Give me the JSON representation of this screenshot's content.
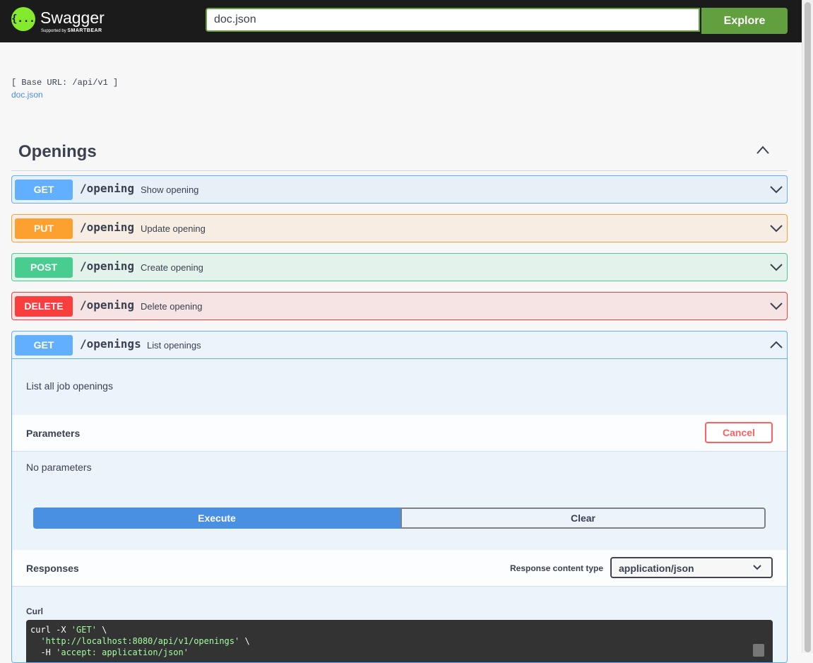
{
  "topbar": {
    "logo_glyph": "{...}",
    "logo_name": "Swagger",
    "logo_sub_prefix": "Supported by",
    "logo_sub_brand": "SMARTBEAR",
    "search_value": "doc.json",
    "explore_label": "Explore",
    "accent_color": "#62a03f"
  },
  "info": {
    "base_url": "[ Base URL: /api/v1 ]",
    "spec_link": "doc.json"
  },
  "tag": {
    "title": "Openings",
    "toggle_icon": "chevron-up-icon"
  },
  "operations": [
    {
      "method": "GET",
      "path": "/opening",
      "summary": "Show opening",
      "color": "#61affe"
    },
    {
      "method": "PUT",
      "path": "/opening",
      "summary": "Update opening",
      "color": "#fca130"
    },
    {
      "method": "POST",
      "path": "/opening",
      "summary": "Create opening",
      "color": "#49cc90"
    },
    {
      "method": "DELETE",
      "path": "/opening",
      "summary": "Delete opening",
      "color": "#f93e3e"
    }
  ],
  "expanded": {
    "method": "GET",
    "path": "/openings",
    "summary": "List openings",
    "description": "List all job openings",
    "parameters_title": "Parameters",
    "cancel_label": "Cancel",
    "no_params": "No parameters",
    "execute_label": "Execute",
    "clear_label": "Clear",
    "responses_title": "Responses",
    "response_content_type_label": "Response content type",
    "response_content_type_value": "application/json",
    "curl_label": "Curl",
    "curl_lines": {
      "l1_cmd": "curl -X ",
      "l1_str": "'GET'",
      "l1_end": " \\",
      "l2_pad": "  ",
      "l2_str": "'http://localhost:8080/api/v1/openings'",
      "l2_end": " \\",
      "l3_cmd": "  -H ",
      "l3_str": "'accept: application/json'"
    }
  }
}
